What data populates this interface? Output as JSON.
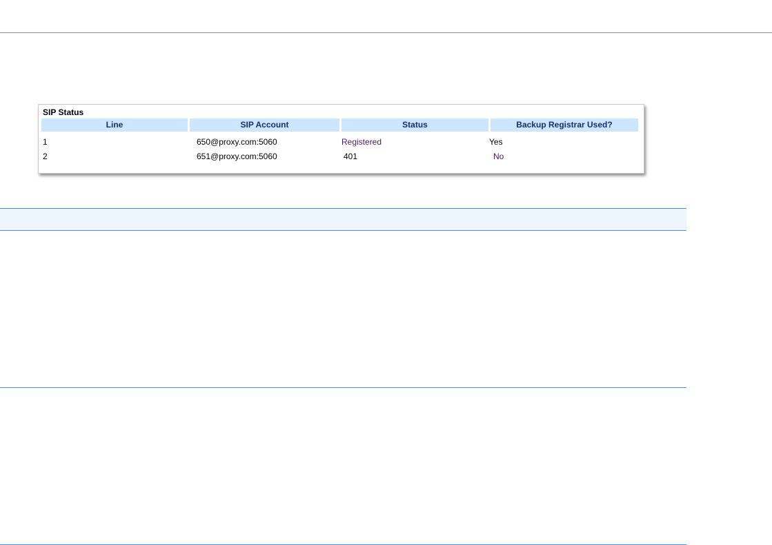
{
  "sip_status": {
    "title": "SIP Status",
    "columns": [
      "Line",
      "SIP Account",
      "Status",
      "Backup Registrar Used?"
    ],
    "rows": [
      {
        "line": "1",
        "account": "650@proxy.com:5060",
        "status": "Registered",
        "backup": "Yes"
      },
      {
        "line": "2",
        "account": "651@proxy.com:5060",
        "status": "401",
        "backup": "No"
      }
    ]
  },
  "colors": {
    "header_fill": "#cde6ff",
    "header_text": "#1a2d6b",
    "rule_blue": "#4a90d9",
    "band_fill": "#eef5fd"
  }
}
